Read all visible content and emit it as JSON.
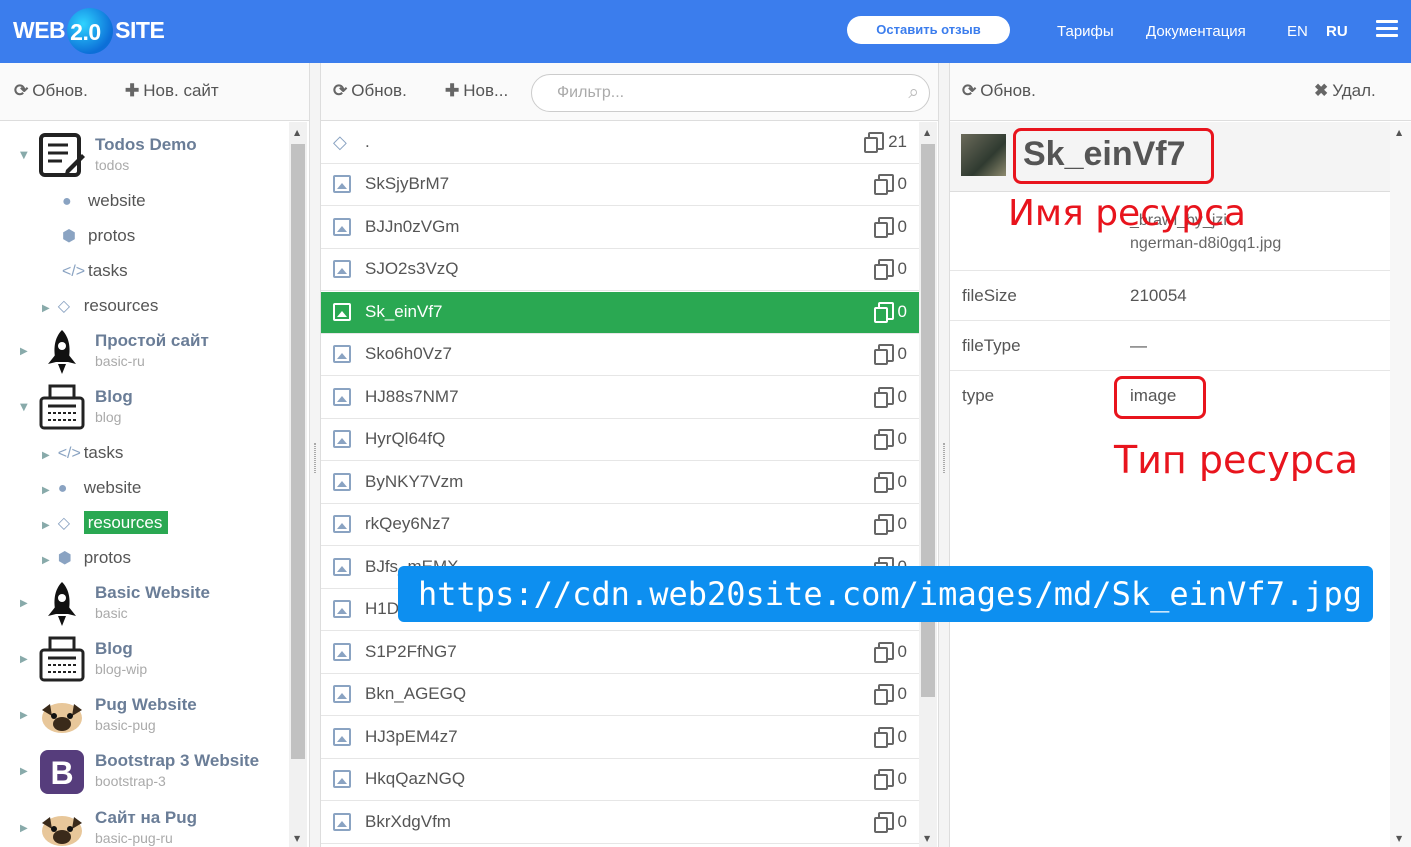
{
  "header": {
    "logo_left": "WEB",
    "logo_mid": "2.0",
    "logo_right": "SITE",
    "feedback": "Оставить отзыв",
    "links": [
      "Тарифы",
      "Документация"
    ],
    "lang_en": "EN",
    "lang_ru": "RU",
    "brand_color": "#3b7ded"
  },
  "projects_panel": {
    "refresh": "Обнов.",
    "new_site": "Нов. сайт",
    "tree": [
      {
        "name": "Todos Demo",
        "slug": "todos",
        "icon": "todo-list-icon",
        "expanded": true,
        "children": [
          {
            "label": "website",
            "icon": "globe-icon"
          },
          {
            "label": "protos",
            "icon": "cubes-icon"
          },
          {
            "label": "tasks",
            "icon": "code-icon"
          },
          {
            "label": "resources",
            "icon": "diamond-icon"
          }
        ]
      },
      {
        "name": "Простой сайт",
        "slug": "basic-ru",
        "icon": "rocket-icon"
      },
      {
        "name": "Blog",
        "slug": "blog",
        "icon": "typewriter-icon",
        "expanded": true,
        "children": [
          {
            "label": "tasks",
            "icon": "code-icon"
          },
          {
            "label": "website",
            "icon": "globe-icon"
          },
          {
            "label": "resources",
            "icon": "diamond-icon",
            "selected": true
          },
          {
            "label": "protos",
            "icon": "cubes-icon"
          }
        ]
      },
      {
        "name": "Basic Website",
        "slug": "basic",
        "icon": "rocket-icon"
      },
      {
        "name": "Blog",
        "slug": "blog-wip",
        "icon": "typewriter-icon"
      },
      {
        "name": "Pug Website",
        "slug": "basic-pug",
        "icon": "pug-icon"
      },
      {
        "name": "Bootstrap 3 Website",
        "slug": "bootstrap-3",
        "icon": "bootstrap-icon"
      },
      {
        "name": "Сайт на Pug",
        "slug": "basic-pug-ru",
        "icon": "pug-icon"
      }
    ]
  },
  "resources_panel": {
    "refresh": "Обнов.",
    "new": "Нов...",
    "filter_placeholder": "Фильтр...",
    "rows": [
      {
        "name": ".",
        "count": "21",
        "root": true
      },
      {
        "name": "SkSjyBrM7",
        "count": "0"
      },
      {
        "name": "BJJn0zVGm",
        "count": "0"
      },
      {
        "name": "SJO2s3VzQ",
        "count": "0"
      },
      {
        "name": "Sk_einVf7",
        "count": "0",
        "selected": true
      },
      {
        "name": "Sko6h0Vz7",
        "count": "0"
      },
      {
        "name": "HJ88s7NM7",
        "count": "0"
      },
      {
        "name": "HyrQl64fQ",
        "count": "0"
      },
      {
        "name": "ByNKY7Vzm",
        "count": "0"
      },
      {
        "name": "rkQey6Nz7",
        "count": "0"
      },
      {
        "name": "BJfs_mEMX",
        "count": "0"
      },
      {
        "name": "H1D",
        "count": "0"
      },
      {
        "name": "S1P2FfNG7",
        "count": "0"
      },
      {
        "name": "Bkn_AGEGQ",
        "count": "0"
      },
      {
        "name": "HJ3pEM4z7",
        "count": "0"
      },
      {
        "name": "HkqQazNGQ",
        "count": "0"
      },
      {
        "name": "BkrXdgVfm",
        "count": "0"
      }
    ]
  },
  "details_panel": {
    "refresh": "Обнов.",
    "delete": "Удал.",
    "title": "Sk_einVf7",
    "name_value_part1": "_brawl_by_jzi",
    "name_value_part2": "ngerman-d8i0gq1.jpg",
    "props": [
      {
        "key": "fileSize",
        "value": "210054"
      },
      {
        "key": "fileType",
        "value": "—"
      },
      {
        "key": "type",
        "value": "image"
      }
    ],
    "annotation_name": "Имя ресурса",
    "annotation_type": "Тип ресурса",
    "annotation_color": "#e8141d"
  },
  "url_banner": "https://cdn.web20site.com/images/md/Sk_einVf7.jpg"
}
